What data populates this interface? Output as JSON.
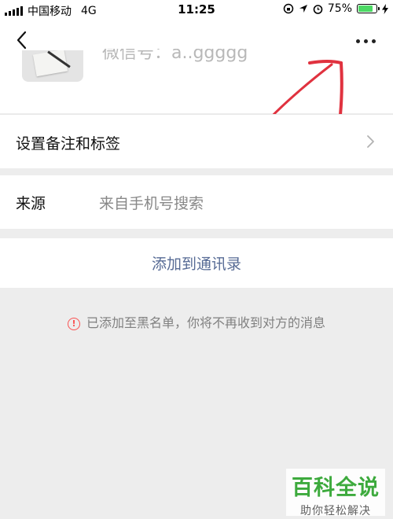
{
  "status_bar": {
    "carrier": "中国移动",
    "network": "4G",
    "time": "11:25",
    "battery": "75%",
    "battery_level": 0.75
  },
  "header": {
    "back_icon": "chevron-left-icon",
    "more_icon": "more-dots-icon",
    "wechat_id_text": "微信号：a..ggggg"
  },
  "rows": {
    "remark_label": "设置备注和标签",
    "source_label": "来源",
    "source_value": "来自手机号搜索"
  },
  "actions": {
    "add_to_contacts": "添加到通讯录"
  },
  "notice": {
    "text": "已添加至黑名单，你将不再收到对方的消息",
    "icon": "exclamation-circle-icon"
  },
  "watermark": {
    "logo": "百科全说",
    "subtitle": "助你轻松解决"
  },
  "colors": {
    "link": "#576b95",
    "warning": "#fa5151",
    "annotation": "#e0323f",
    "background": "#ededed"
  }
}
